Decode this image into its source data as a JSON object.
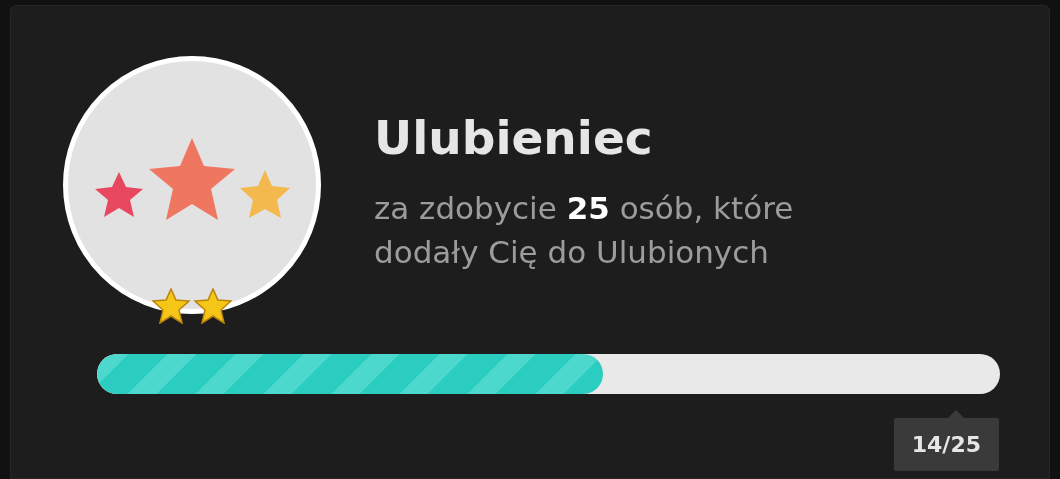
{
  "title": "Ulubieniec",
  "description": "za zdobycie **25** osób, które dodały Cię do Ulubionych",
  "progress": {
    "level": 0.56,
    "reading": "14/25"
  }
}
